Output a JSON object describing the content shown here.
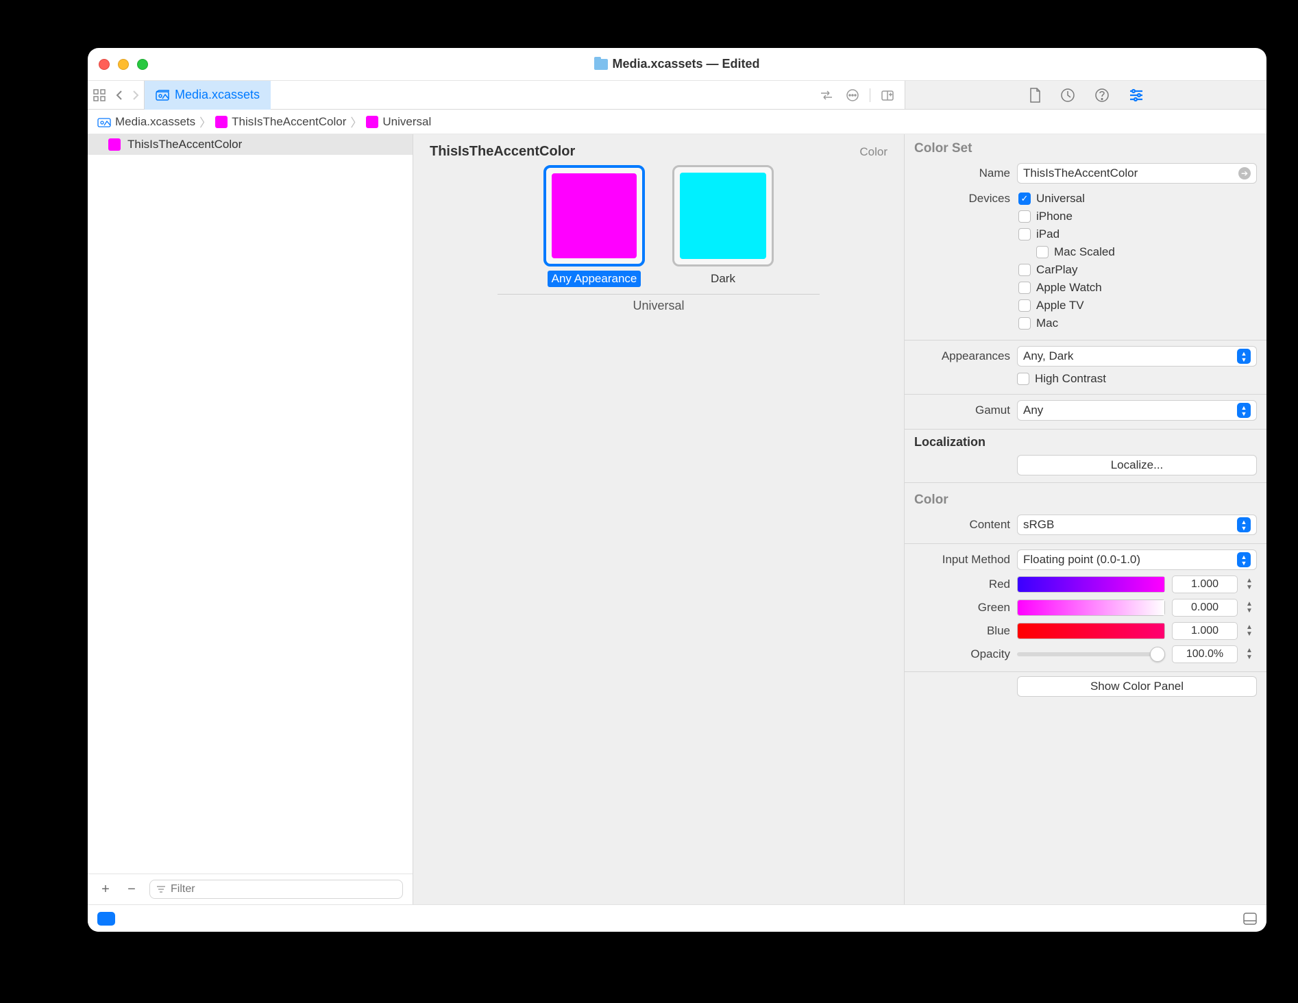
{
  "window": {
    "title": "Media.xcassets — Edited"
  },
  "tab": {
    "label": "Media.xcassets"
  },
  "breadcrumb": {
    "root": "Media.xcassets",
    "asset": "ThisIsTheAccentColor",
    "variant": "Universal",
    "asset_swatch_color": "#ff00ff"
  },
  "outline": {
    "item": {
      "label": "ThisIsTheAccentColor",
      "swatch_color": "#ff00ff"
    },
    "add_glyph": "+",
    "remove_glyph": "−",
    "filter_placeholder": "Filter"
  },
  "canvas": {
    "title": "ThisIsTheAccentColor",
    "type_label": "Color",
    "swatches": {
      "any": {
        "label": "Any Appearance",
        "color": "#ff00ff",
        "selected": true
      },
      "dark": {
        "label": "Dark",
        "color": "#00f0ff",
        "selected": false
      }
    },
    "group_label": "Universal"
  },
  "inspector": {
    "colorset_heading": "Color Set",
    "name_label": "Name",
    "name_value": "ThisIsTheAccentColor",
    "devices_label": "Devices",
    "devices": {
      "universal": {
        "label": "Universal",
        "checked": true
      },
      "iphone": {
        "label": "iPhone",
        "checked": false
      },
      "ipad": {
        "label": "iPad",
        "checked": false
      },
      "macscaled": {
        "label": "Mac Scaled",
        "checked": false,
        "indent": true
      },
      "carplay": {
        "label": "CarPlay",
        "checked": false
      },
      "watch": {
        "label": "Apple Watch",
        "checked": false
      },
      "appletv": {
        "label": "Apple TV",
        "checked": false
      },
      "mac": {
        "label": "Mac",
        "checked": false
      }
    },
    "appearances_label": "Appearances",
    "appearances_value": "Any, Dark",
    "highcontrast_label": "High Contrast",
    "highcontrast_checked": false,
    "gamut_label": "Gamut",
    "gamut_value": "Any",
    "localization_heading": "Localization",
    "localize_button": "Localize...",
    "color_heading": "Color",
    "content_label": "Content",
    "content_value": "sRGB",
    "input_method_label": "Input Method",
    "input_method_value": "Floating point (0.0-1.0)",
    "red_label": "Red",
    "green_label": "Green",
    "blue_label": "Blue",
    "opacity_label": "Opacity",
    "red_value": "1.000",
    "green_value": "0.000",
    "blue_value": "1.000",
    "opacity_value": "100.0%",
    "red_gradient": [
      "#3a00ff",
      "#ff00ff"
    ],
    "green_gradient": [
      "#ff00ff",
      "#ffffff"
    ],
    "blue_gradient": [
      "#ff0000",
      "#ff0070"
    ],
    "show_color_panel": "Show Color Panel"
  }
}
